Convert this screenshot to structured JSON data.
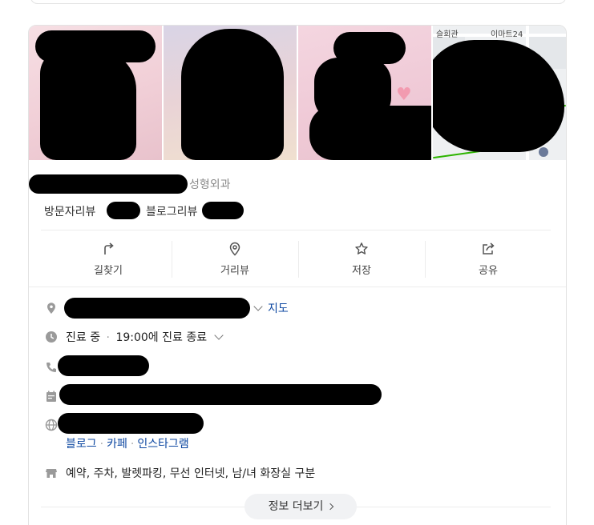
{
  "place": {
    "category": "성형외과",
    "visitor_review_label": "방문자리뷰",
    "blog_review_label": "블로그리뷰"
  },
  "map": {
    "label_1": "슬회관",
    "label_2": "이마트24"
  },
  "actions": {
    "directions": "길찾기",
    "street_view": "거리뷰",
    "save": "저장",
    "share": "공유"
  },
  "info": {
    "map_link": "지도",
    "hours_status": "진료 중",
    "hours_sep": "·",
    "hours_detail": "19:00에 진료 종료",
    "links": [
      "블로그",
      "카페",
      "인스타그램"
    ],
    "link_sep": "·",
    "amenities": "예약, 주차, 발렛파킹, 무선 인터넷, 남/녀 화장실 구분"
  },
  "more_button": "정보 더보기",
  "colors": {
    "link": "#0d47a1",
    "map_route": "#2db400",
    "border": "#e3e3e3"
  }
}
